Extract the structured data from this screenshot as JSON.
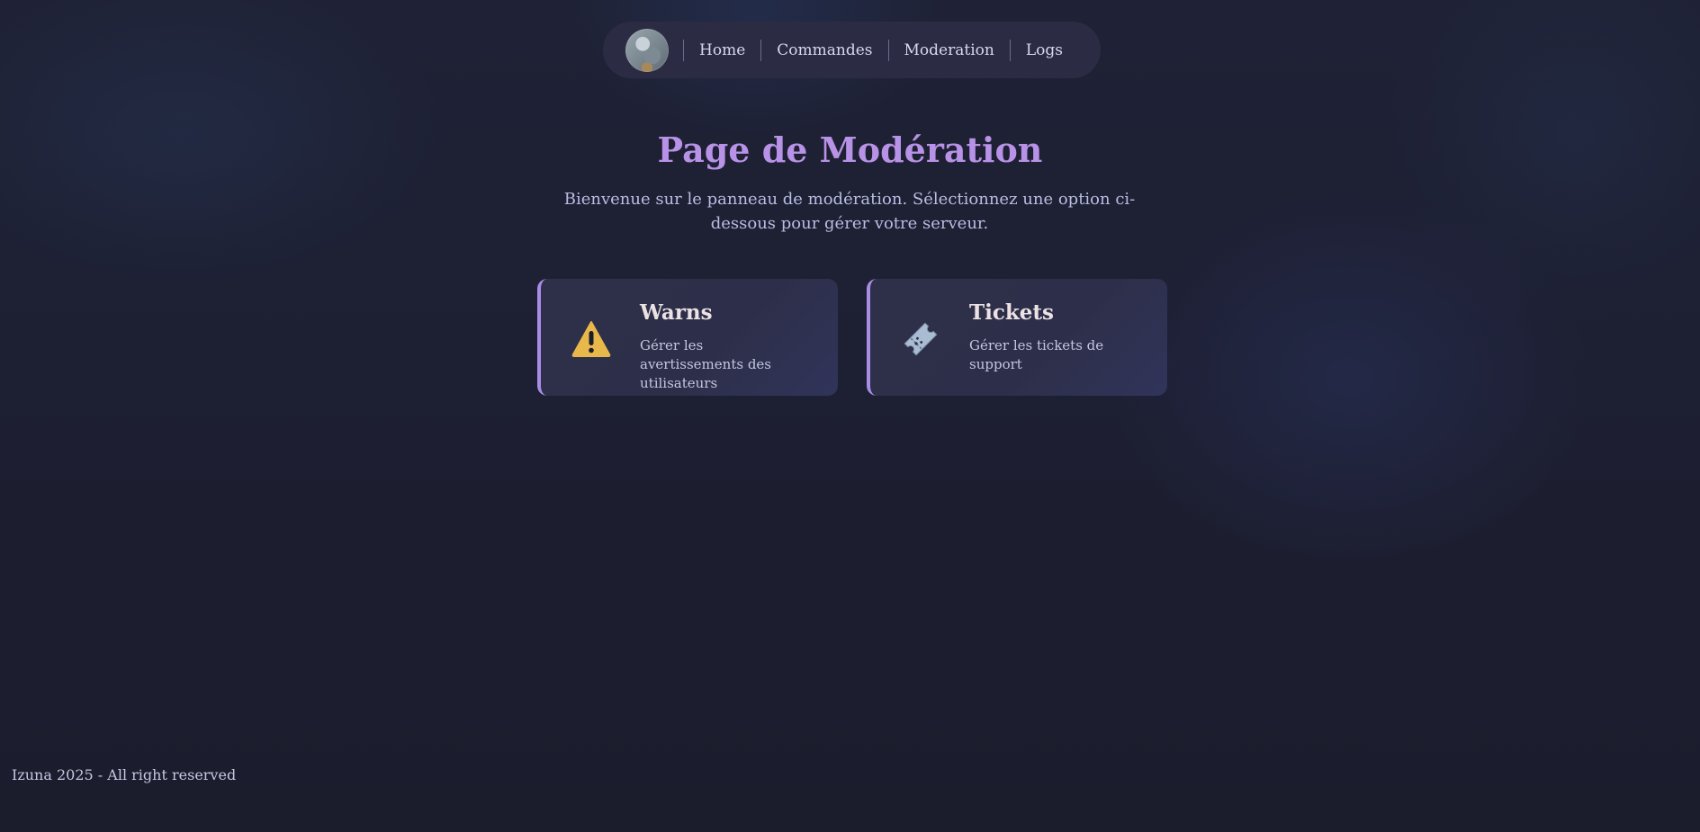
{
  "nav": {
    "links": [
      {
        "label": "Home"
      },
      {
        "label": "Commandes"
      },
      {
        "label": "Moderation"
      },
      {
        "label": "Logs"
      }
    ],
    "avatar_icon": "user-avatar"
  },
  "page": {
    "title": "Page de Modération",
    "subtitle": "Bienvenue sur le panneau de modération. Sélectionnez une option ci-dessous pour gérer votre serveur."
  },
  "cards": [
    {
      "title": "Warns",
      "description": "Gérer les avertissements des utilisateurs",
      "icon": "warning-icon"
    },
    {
      "title": "Tickets",
      "description": "Gérer les tickets de support",
      "icon": "ticket-icon"
    }
  ],
  "footer": {
    "text": "Izuna 2025 - All right reserved"
  },
  "colors": {
    "accent": "#b892e6",
    "card_border": "#a98ce4",
    "background": "#1d1f32",
    "warning": "#e8b84b"
  }
}
